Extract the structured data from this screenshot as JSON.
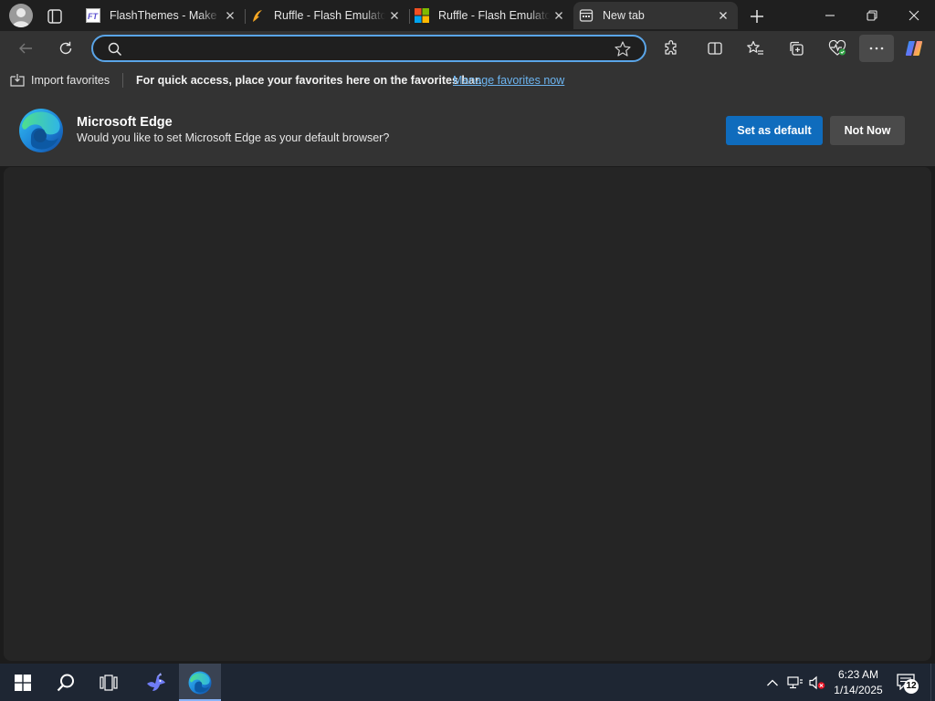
{
  "tabs": [
    {
      "title": "FlashThemes - Make your own animations",
      "icon": "flashthemes-favicon"
    },
    {
      "title": "Ruffle - Flash Emulator",
      "icon": "ruffle-favicon"
    },
    {
      "title": "Ruffle - Flash Emulator",
      "icon": "microsoft-favicon"
    },
    {
      "title": "New tab",
      "icon": "newtab-icon",
      "active": true
    }
  ],
  "address_bar": {
    "value": "",
    "placeholder": ""
  },
  "favorites_bar": {
    "import_label": "Import favorites",
    "hint_text": "For quick access, place your favorites here on the favorites bar.",
    "manage_link": "Manage favorites now"
  },
  "banner": {
    "title": "Microsoft Edge",
    "message": "Would you like to set Microsoft Edge as your default browser?",
    "primary_button": "Set as default",
    "secondary_button": "Not Now"
  },
  "taskbar": {
    "time": "6:23 AM",
    "date": "1/14/2025",
    "notification_count": "12"
  },
  "colors": {
    "accent": "#0f6cbd",
    "address_border": "#5aa5e8",
    "link": "#6cb4f0"
  }
}
